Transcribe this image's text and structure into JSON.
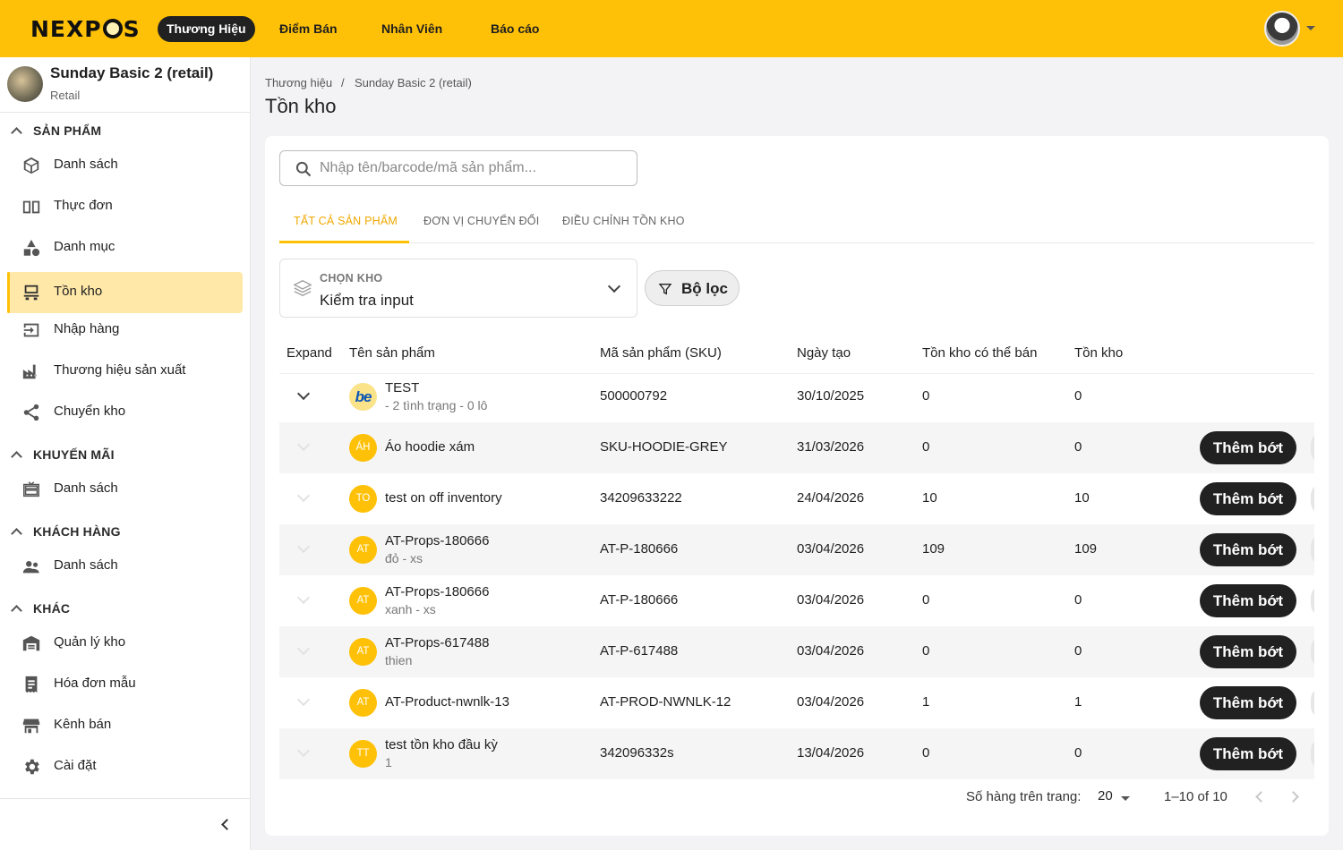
{
  "topbar": {
    "logo": "NEXPOS",
    "nav": [
      "Thương Hiệu",
      "Điểm Bán",
      "Nhân Viên",
      "Báo cáo"
    ],
    "active_nav": "Thương Hiệu"
  },
  "sidebar": {
    "brand_name": "Sunday Basic 2 (retail)",
    "brand_sub": "Retail",
    "sections": [
      {
        "title": "SẢN PHẨM",
        "items": [
          {
            "label": "Danh sách",
            "icon": "box-icon"
          },
          {
            "label": "Thực đơn",
            "icon": "menu-book-icon"
          },
          {
            "label": "Danh mục",
            "icon": "category-icon"
          },
          {
            "label": "Tồn kho",
            "icon": "inventory-icon",
            "active": true
          },
          {
            "label": "Nhập hàng",
            "icon": "input-icon"
          },
          {
            "label": "Thương hiệu sản xuất",
            "icon": "factory-icon"
          },
          {
            "label": "Chuyển kho",
            "icon": "share-icon"
          }
        ]
      },
      {
        "title": "KHUYẾN MÃI",
        "items": [
          {
            "label": "Danh sách",
            "icon": "gift-card-icon"
          }
        ]
      },
      {
        "title": "KHÁCH HÀNG",
        "items": [
          {
            "label": "Danh sách",
            "icon": "people-icon"
          }
        ]
      },
      {
        "title": "KHÁC",
        "items": [
          {
            "label": "Quản lý kho",
            "icon": "warehouse-icon"
          },
          {
            "label": "Hóa đơn mẫu",
            "icon": "receipt-icon"
          },
          {
            "label": "Kênh bán",
            "icon": "store-icon"
          },
          {
            "label": "Cài đặt",
            "icon": "gear-icon"
          }
        ]
      }
    ]
  },
  "breadcrumb": [
    "Thương hiệu",
    "Sunday Basic 2 (retail)"
  ],
  "breadcrumb_sep": "/",
  "page_title": "Tồn kho",
  "search": {
    "placeholder": "Nhập tên/barcode/mã sản phẩm...",
    "value": ""
  },
  "tabs": [
    "TẤT CẢ SẢN PHẨM",
    "ĐƠN VỊ CHUYỂN ĐỔI",
    "ĐIỀU CHỈNH TỒN KHO"
  ],
  "active_tab": "TẤT CẢ SẢN PHẨM",
  "warehouse_select": {
    "label": "CHỌN KHO",
    "value": "Kiểm tra input"
  },
  "filter_label": "Bộ lọc",
  "table": {
    "columns": [
      "Expand",
      "Tên sản phẩm",
      "Mã sản phẩm (SKU)",
      "Ngày tạo",
      "Tồn kho có thể bán",
      "Tồn kho"
    ],
    "action_label": "Thêm bớt",
    "rows": [
      {
        "avatar": "be",
        "name": "TEST",
        "sub": "- 2 tình trạng - 0 lô",
        "sku": "500000792",
        "date": "30/10/2025",
        "sellable": "0",
        "stock": "0",
        "expandable": true,
        "action": false
      },
      {
        "avatar": "ÁH",
        "name": "Áo hoodie xám",
        "sub": "",
        "sku": "SKU-HOODIE-GREY",
        "date": "31/03/2026",
        "sellable": "0",
        "stock": "0",
        "expandable": false,
        "action": true
      },
      {
        "avatar": "TO",
        "name": "test on off inventory",
        "sub": "",
        "sku": "34209633222",
        "date": "24/04/2026",
        "sellable": "10",
        "stock": "10",
        "expandable": false,
        "action": true
      },
      {
        "avatar": "AT",
        "name": "AT-Props-180666",
        "sub": "đỏ - xs",
        "sku": "AT-P-180666",
        "date": "03/04/2026",
        "sellable": "109",
        "stock": "109",
        "expandable": false,
        "action": true
      },
      {
        "avatar": "AT",
        "name": "AT-Props-180666",
        "sub": "xanh - xs",
        "sku": "AT-P-180666",
        "date": "03/04/2026",
        "sellable": "0",
        "stock": "0",
        "expandable": false,
        "action": true
      },
      {
        "avatar": "AT",
        "name": "AT-Props-617488",
        "sub": "thien",
        "sku": "AT-P-617488",
        "date": "03/04/2026",
        "sellable": "0",
        "stock": "0",
        "expandable": false,
        "action": true
      },
      {
        "avatar": "AT",
        "name": "AT-Product-nwnlk-13",
        "sub": "",
        "sku": "AT-PROD-NWNLK-12",
        "date": "03/04/2026",
        "sellable": "1",
        "stock": "1",
        "expandable": false,
        "action": true
      },
      {
        "avatar": "TT",
        "name": "test tồn kho đầu kỳ",
        "sub": "1",
        "sku": "342096332s",
        "date": "13/04/2026",
        "sellable": "0",
        "stock": "0",
        "expandable": false,
        "action": true
      }
    ]
  },
  "pagination": {
    "rows_per_page_label": "Số hàng trên trang:",
    "rows_per_page": "20",
    "range": "1–10 of 10"
  },
  "colors": {
    "accent": "#ffc107",
    "dark": "#212121",
    "active_bg": "#ffe8a8"
  }
}
